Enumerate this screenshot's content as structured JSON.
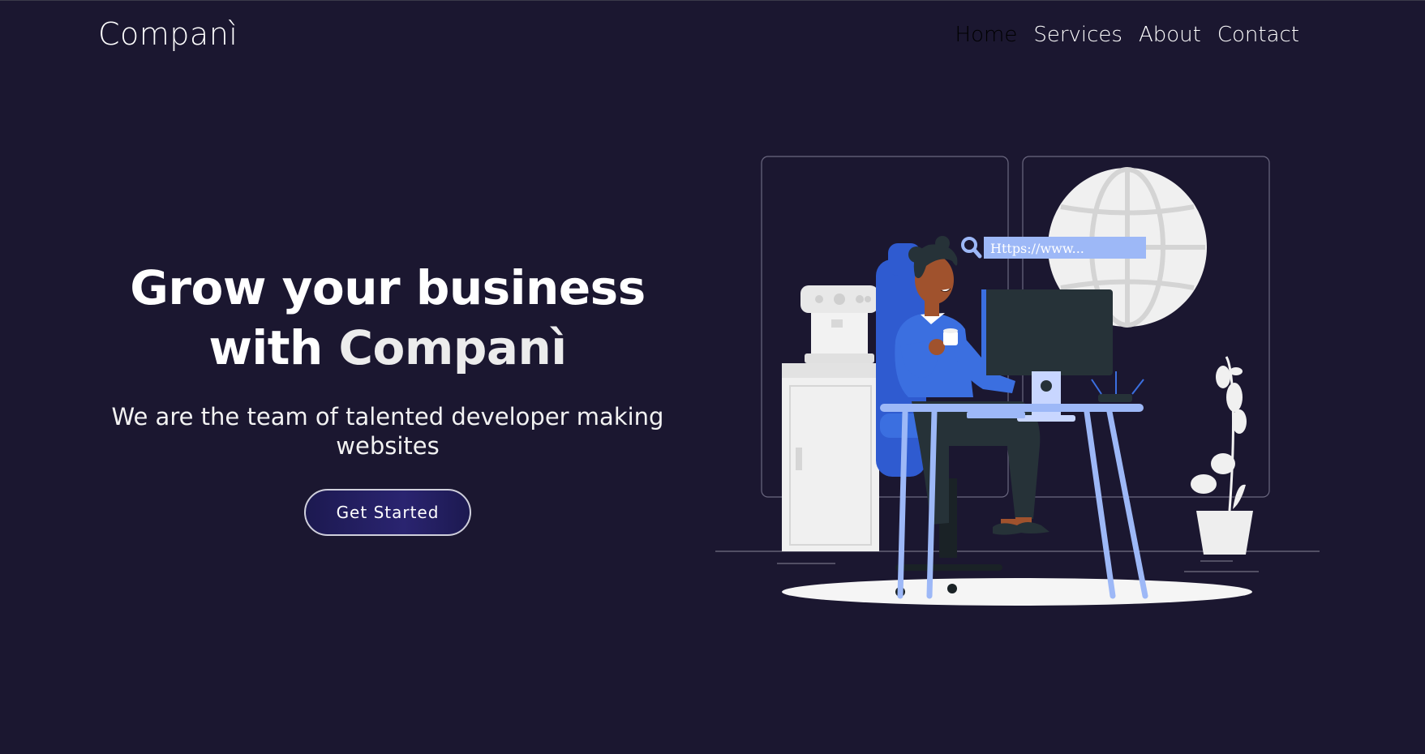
{
  "brand": {
    "name": "Companì"
  },
  "nav": {
    "items": [
      {
        "label": "Home",
        "active": true
      },
      {
        "label": "Services",
        "active": false
      },
      {
        "label": "About",
        "active": false
      },
      {
        "label": "Contact",
        "active": false
      }
    ]
  },
  "hero": {
    "title_line1": "Grow your business",
    "title_prefix": "with ",
    "title_brand": "Companì",
    "subtitle": "We are the team of talented developer making websites",
    "cta_label": "Get Started"
  },
  "illustration": {
    "url_text": "Https://www..."
  },
  "colors": {
    "background": "#1b1730",
    "accent_blue": "#3b6fe0",
    "light_blue": "#9db8f7",
    "dark": "#263238"
  }
}
